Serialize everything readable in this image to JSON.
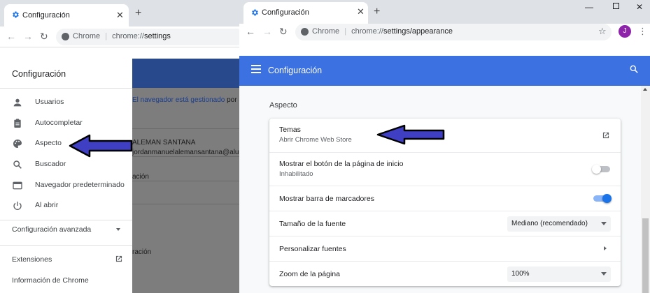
{
  "left_window": {
    "tab_title": "Configuración",
    "address": {
      "host": "Chrome",
      "url_prefix": "chrome://",
      "url_path": "settings"
    },
    "page_header_title": "Configuración",
    "underlay": {
      "managed_notice_prefix": "El navegador está gestionado",
      "managed_notice_suffix": " por alu",
      "user_name": "ALEMAN SANTANA",
      "user_email": "jordanmanuelalemansantana@alumn",
      "sync_text": "ación",
      "extra_text": "ración"
    },
    "drawer": {
      "title": "Configuración",
      "items": [
        {
          "label": "Usuarios",
          "icon": "person-icon"
        },
        {
          "label": "Autocompletar",
          "icon": "clipboard-icon"
        },
        {
          "label": "Aspecto",
          "icon": "palette-icon"
        },
        {
          "label": "Buscador",
          "icon": "search-icon"
        },
        {
          "label": "Navegador predeterminado",
          "icon": "browser-icon"
        },
        {
          "label": "Al abrir",
          "icon": "power-icon"
        }
      ],
      "advanced_label": "Configuración avanzada",
      "extensions_label": "Extensiones",
      "about_label": "Información de Chrome"
    }
  },
  "right_window": {
    "tab_title": "Configuración",
    "address": {
      "host": "Chrome",
      "url_prefix": "chrome://",
      "url_path": "settings/appearance"
    },
    "avatar_initial": "J",
    "appbar_title": "Configuración",
    "section_title": "Aspecto",
    "rows": {
      "themes_label": "Temas",
      "themes_sub": "Abrir Chrome Web Store",
      "home_button_label": "Mostrar el botón de la página de inicio",
      "home_button_sub": "Inhabilitado",
      "home_button_enabled": false,
      "bookmarks_bar_label": "Mostrar barra de marcadores",
      "bookmarks_bar_enabled": true,
      "font_size_label": "Tamaño de la fuente",
      "font_size_value": "Mediano (recomendado)",
      "custom_fonts_label": "Personalizar fuentes",
      "zoom_label": "Zoom de la página",
      "zoom_value": "100%"
    }
  },
  "colors": {
    "accent_blue": "#3b71e0",
    "arrow_fill": "#3f3fc4",
    "toggle_on_track": "#8ab4f8",
    "toggle_on_knob": "#1a73e8",
    "avatar": "#8e24aa"
  }
}
